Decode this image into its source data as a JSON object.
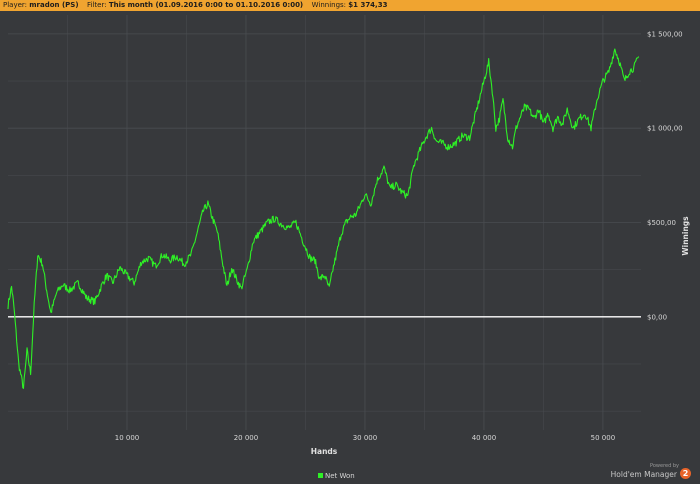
{
  "header": {
    "player_label": "Player:",
    "player_value": "mradon (PS)",
    "filter_label": "Filter:",
    "filter_value": "This month (01.09.2016 0:00 to 01.10.2016 0:00)",
    "winnings_label": "Winnings:",
    "winnings_value": "$1 374,33"
  },
  "footer": {
    "powered_by": "Powered by",
    "brand": "Hold'em Manager",
    "badge": "2"
  },
  "colors": {
    "background": "#37393c",
    "header": "#f0a430",
    "series": "#2ef026",
    "zero_line": "#ffffff",
    "grid": "#4a4d51"
  },
  "chart_data": {
    "type": "line",
    "title": "",
    "xlabel": "Hands",
    "ylabel": "Winnings",
    "xlim": [
      0,
      53200
    ],
    "ylim": [
      -600,
      1600
    ],
    "x_ticks": [
      10000,
      20000,
      30000,
      40000,
      50000
    ],
    "x_tick_labels": [
      "10 000",
      "20 000",
      "30 000",
      "40 000",
      "50 000"
    ],
    "y_ticks": [
      0,
      500,
      1000,
      1500
    ],
    "y_tick_labels": [
      "$0,00",
      "$500,00",
      "$1 000,00",
      "$1 500,00"
    ],
    "grid": true,
    "legend": "bottom-center",
    "series": [
      {
        "name": "Net Won",
        "x": [
          0,
          300,
          500,
          900,
          1300,
          1600,
          1900,
          2200,
          2500,
          2900,
          3200,
          3600,
          4100,
          4600,
          5200,
          5900,
          6600,
          7300,
          7900,
          8300,
          8800,
          9400,
          10000,
          10600,
          11200,
          11800,
          12400,
          13000,
          13600,
          14200,
          14800,
          15400,
          16000,
          16400,
          16800,
          17200,
          17600,
          18000,
          18400,
          18800,
          19200,
          19600,
          20100,
          20600,
          21200,
          21800,
          22400,
          23000,
          23600,
          24200,
          24800,
          25400,
          25800,
          26200,
          26600,
          27000,
          27300,
          27600,
          28000,
          28400,
          28800,
          29200,
          29600,
          30000,
          30500,
          31000,
          31600,
          32100,
          32600,
          33100,
          33600,
          34100,
          34600,
          35100,
          35600,
          36000,
          36500,
          37000,
          37600,
          38200,
          38800,
          39400,
          40000,
          40400,
          40700,
          41000,
          41300,
          41600,
          42000,
          42400,
          42700,
          43000,
          43400,
          43800,
          44200,
          44600,
          45000,
          45400,
          45800,
          46200,
          46600,
          47000,
          47500,
          48000,
          48500,
          49000,
          49500,
          50000,
          50500,
          51000,
          51400,
          51800,
          52200,
          52600,
          53000
        ],
        "values": [
          60,
          160,
          50,
          -250,
          -380,
          -180,
          -300,
          60,
          330,
          280,
          160,
          20,
          130,
          170,
          140,
          180,
          100,
          80,
          170,
          220,
          180,
          260,
          220,
          180,
          290,
          310,
          270,
          330,
          300,
          320,
          280,
          330,
          470,
          560,
          600,
          520,
          450,
          300,
          160,
          260,
          200,
          150,
          250,
          400,
          450,
          500,
          520,
          490,
          470,
          500,
          400,
          310,
          300,
          200,
          220,
          150,
          250,
          330,
          440,
          500,
          530,
          540,
          590,
          650,
          600,
          720,
          790,
          680,
          700,
          660,
          640,
          800,
          880,
          950,
          1000,
          930,
          920,
          900,
          920,
          960,
          950,
          1100,
          1250,
          1350,
          1200,
          1000,
          1050,
          1150,
          950,
          900,
          1000,
          1050,
          1110,
          1100,
          1050,
          1100,
          1020,
          1080,
          1000,
          1060,
          1020,
          1100,
          1000,
          1050,
          1080,
          1000,
          1150,
          1250,
          1300,
          1420,
          1350,
          1250,
          1300,
          1320,
          1380
        ]
      }
    ]
  }
}
